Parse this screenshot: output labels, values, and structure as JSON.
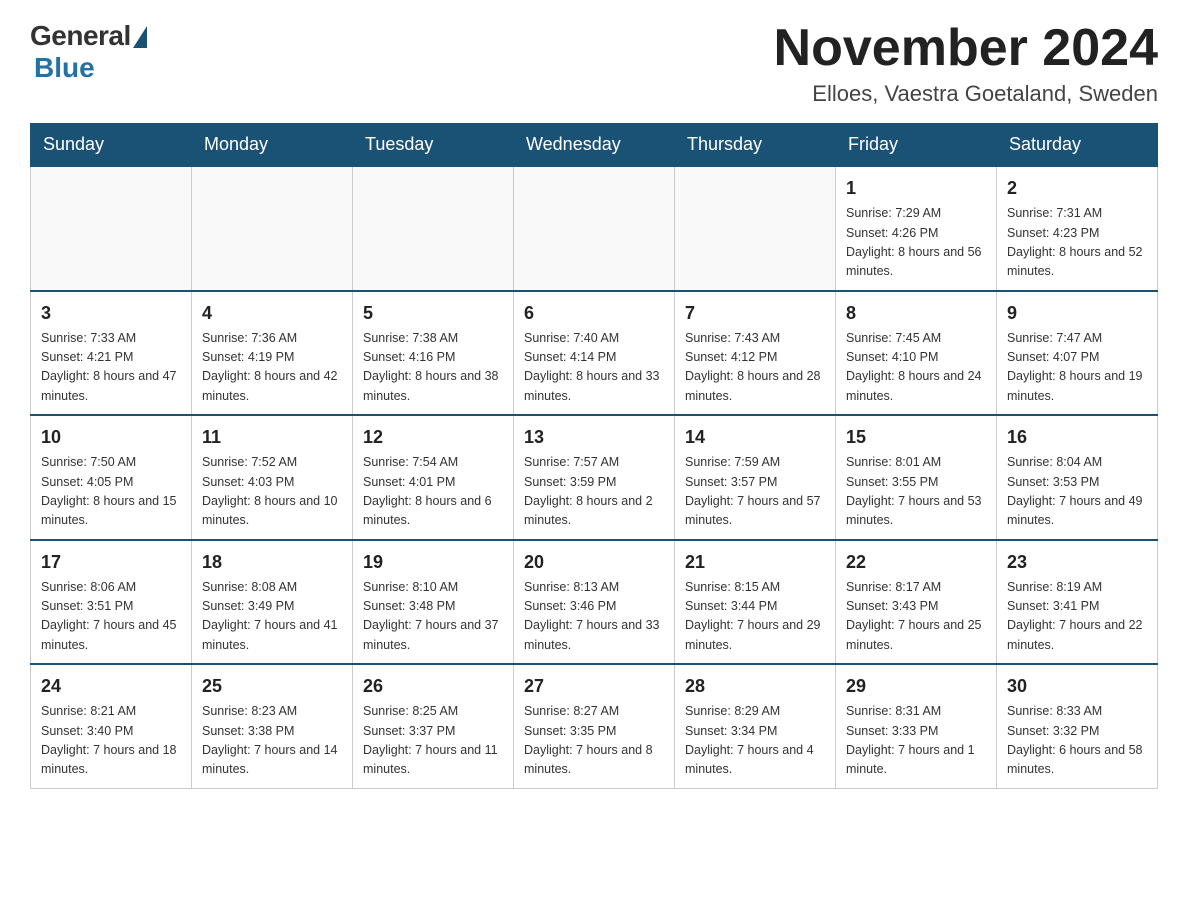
{
  "header": {
    "logo_general": "General",
    "logo_blue": "Blue",
    "title": "November 2024",
    "location": "Elloes, Vaestra Goetaland, Sweden"
  },
  "days_of_week": [
    "Sunday",
    "Monday",
    "Tuesday",
    "Wednesday",
    "Thursday",
    "Friday",
    "Saturday"
  ],
  "weeks": [
    [
      {
        "day": "",
        "sunrise": "",
        "sunset": "",
        "daylight": ""
      },
      {
        "day": "",
        "sunrise": "",
        "sunset": "",
        "daylight": ""
      },
      {
        "day": "",
        "sunrise": "",
        "sunset": "",
        "daylight": ""
      },
      {
        "day": "",
        "sunrise": "",
        "sunset": "",
        "daylight": ""
      },
      {
        "day": "",
        "sunrise": "",
        "sunset": "",
        "daylight": ""
      },
      {
        "day": "1",
        "sunrise": "Sunrise: 7:29 AM",
        "sunset": "Sunset: 4:26 PM",
        "daylight": "Daylight: 8 hours and 56 minutes."
      },
      {
        "day": "2",
        "sunrise": "Sunrise: 7:31 AM",
        "sunset": "Sunset: 4:23 PM",
        "daylight": "Daylight: 8 hours and 52 minutes."
      }
    ],
    [
      {
        "day": "3",
        "sunrise": "Sunrise: 7:33 AM",
        "sunset": "Sunset: 4:21 PM",
        "daylight": "Daylight: 8 hours and 47 minutes."
      },
      {
        "day": "4",
        "sunrise": "Sunrise: 7:36 AM",
        "sunset": "Sunset: 4:19 PM",
        "daylight": "Daylight: 8 hours and 42 minutes."
      },
      {
        "day": "5",
        "sunrise": "Sunrise: 7:38 AM",
        "sunset": "Sunset: 4:16 PM",
        "daylight": "Daylight: 8 hours and 38 minutes."
      },
      {
        "day": "6",
        "sunrise": "Sunrise: 7:40 AM",
        "sunset": "Sunset: 4:14 PM",
        "daylight": "Daylight: 8 hours and 33 minutes."
      },
      {
        "day": "7",
        "sunrise": "Sunrise: 7:43 AM",
        "sunset": "Sunset: 4:12 PM",
        "daylight": "Daylight: 8 hours and 28 minutes."
      },
      {
        "day": "8",
        "sunrise": "Sunrise: 7:45 AM",
        "sunset": "Sunset: 4:10 PM",
        "daylight": "Daylight: 8 hours and 24 minutes."
      },
      {
        "day": "9",
        "sunrise": "Sunrise: 7:47 AM",
        "sunset": "Sunset: 4:07 PM",
        "daylight": "Daylight: 8 hours and 19 minutes."
      }
    ],
    [
      {
        "day": "10",
        "sunrise": "Sunrise: 7:50 AM",
        "sunset": "Sunset: 4:05 PM",
        "daylight": "Daylight: 8 hours and 15 minutes."
      },
      {
        "day": "11",
        "sunrise": "Sunrise: 7:52 AM",
        "sunset": "Sunset: 4:03 PM",
        "daylight": "Daylight: 8 hours and 10 minutes."
      },
      {
        "day": "12",
        "sunrise": "Sunrise: 7:54 AM",
        "sunset": "Sunset: 4:01 PM",
        "daylight": "Daylight: 8 hours and 6 minutes."
      },
      {
        "day": "13",
        "sunrise": "Sunrise: 7:57 AM",
        "sunset": "Sunset: 3:59 PM",
        "daylight": "Daylight: 8 hours and 2 minutes."
      },
      {
        "day": "14",
        "sunrise": "Sunrise: 7:59 AM",
        "sunset": "Sunset: 3:57 PM",
        "daylight": "Daylight: 7 hours and 57 minutes."
      },
      {
        "day": "15",
        "sunrise": "Sunrise: 8:01 AM",
        "sunset": "Sunset: 3:55 PM",
        "daylight": "Daylight: 7 hours and 53 minutes."
      },
      {
        "day": "16",
        "sunrise": "Sunrise: 8:04 AM",
        "sunset": "Sunset: 3:53 PM",
        "daylight": "Daylight: 7 hours and 49 minutes."
      }
    ],
    [
      {
        "day": "17",
        "sunrise": "Sunrise: 8:06 AM",
        "sunset": "Sunset: 3:51 PM",
        "daylight": "Daylight: 7 hours and 45 minutes."
      },
      {
        "day": "18",
        "sunrise": "Sunrise: 8:08 AM",
        "sunset": "Sunset: 3:49 PM",
        "daylight": "Daylight: 7 hours and 41 minutes."
      },
      {
        "day": "19",
        "sunrise": "Sunrise: 8:10 AM",
        "sunset": "Sunset: 3:48 PM",
        "daylight": "Daylight: 7 hours and 37 minutes."
      },
      {
        "day": "20",
        "sunrise": "Sunrise: 8:13 AM",
        "sunset": "Sunset: 3:46 PM",
        "daylight": "Daylight: 7 hours and 33 minutes."
      },
      {
        "day": "21",
        "sunrise": "Sunrise: 8:15 AM",
        "sunset": "Sunset: 3:44 PM",
        "daylight": "Daylight: 7 hours and 29 minutes."
      },
      {
        "day": "22",
        "sunrise": "Sunrise: 8:17 AM",
        "sunset": "Sunset: 3:43 PM",
        "daylight": "Daylight: 7 hours and 25 minutes."
      },
      {
        "day": "23",
        "sunrise": "Sunrise: 8:19 AM",
        "sunset": "Sunset: 3:41 PM",
        "daylight": "Daylight: 7 hours and 22 minutes."
      }
    ],
    [
      {
        "day": "24",
        "sunrise": "Sunrise: 8:21 AM",
        "sunset": "Sunset: 3:40 PM",
        "daylight": "Daylight: 7 hours and 18 minutes."
      },
      {
        "day": "25",
        "sunrise": "Sunrise: 8:23 AM",
        "sunset": "Sunset: 3:38 PM",
        "daylight": "Daylight: 7 hours and 14 minutes."
      },
      {
        "day": "26",
        "sunrise": "Sunrise: 8:25 AM",
        "sunset": "Sunset: 3:37 PM",
        "daylight": "Daylight: 7 hours and 11 minutes."
      },
      {
        "day": "27",
        "sunrise": "Sunrise: 8:27 AM",
        "sunset": "Sunset: 3:35 PM",
        "daylight": "Daylight: 7 hours and 8 minutes."
      },
      {
        "day": "28",
        "sunrise": "Sunrise: 8:29 AM",
        "sunset": "Sunset: 3:34 PM",
        "daylight": "Daylight: 7 hours and 4 minutes."
      },
      {
        "day": "29",
        "sunrise": "Sunrise: 8:31 AM",
        "sunset": "Sunset: 3:33 PM",
        "daylight": "Daylight: 7 hours and 1 minute."
      },
      {
        "day": "30",
        "sunrise": "Sunrise: 8:33 AM",
        "sunset": "Sunset: 3:32 PM",
        "daylight": "Daylight: 6 hours and 58 minutes."
      }
    ]
  ]
}
